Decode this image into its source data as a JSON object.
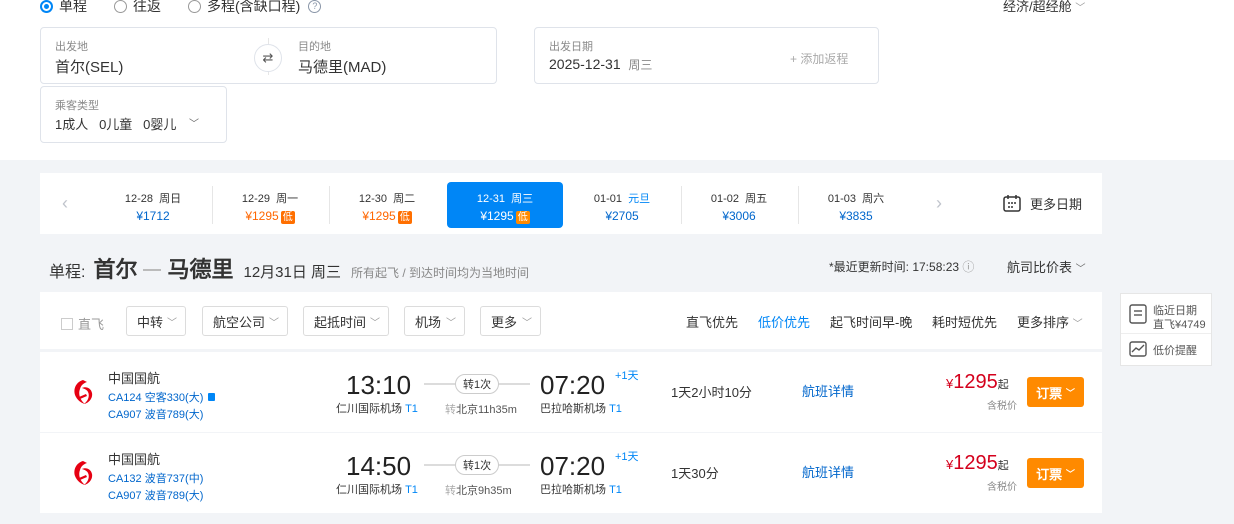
{
  "trip_types": [
    {
      "label": "单程",
      "selected": true
    },
    {
      "label": "往返",
      "selected": false
    },
    {
      "label": "多程(含缺口程)",
      "selected": false
    }
  ],
  "cabin_class": "经济/超经舱",
  "search": {
    "from_label": "出发地",
    "from_value": "首尔(SEL)",
    "to_label": "目的地",
    "to_value": "马德里(MAD)",
    "date_label": "出发日期",
    "date_value": "2025-12-31",
    "date_weekday": "周三",
    "add_leg": "+ 添加返程",
    "passenger_label": "乘客类型",
    "passenger_value": "1成人   0儿童   0婴儿"
  },
  "date_strip": [
    {
      "date": "12-28",
      "weekday": "周日",
      "price": "¥1712",
      "low": false,
      "selected": false
    },
    {
      "date": "12-29",
      "weekday": "周一",
      "price": "¥1295",
      "low": true,
      "selected": false
    },
    {
      "date": "12-30",
      "weekday": "周二",
      "price": "¥1295",
      "low": true,
      "selected": false
    },
    {
      "date": "12-31",
      "weekday": "周三",
      "price": "¥1295",
      "low": true,
      "selected": true
    },
    {
      "date": "01-01",
      "weekday": "元旦",
      "price": "¥2705",
      "low": false,
      "selected": false
    },
    {
      "date": "01-02",
      "weekday": "周五",
      "price": "¥3006",
      "low": false,
      "selected": false
    },
    {
      "date": "01-03",
      "weekday": "周六",
      "price": "¥3835",
      "low": false,
      "selected": false
    }
  ],
  "low_tag": "低",
  "more_dates": "更多日期",
  "route": {
    "prefix": "单程:",
    "from": "首尔",
    "to": "马德里",
    "date": "12月31日 周三",
    "note": "所有起飞 / 到达时间均为当地时间",
    "updated": "*最近更新时间: 17:58:23",
    "compare": "航司比价表"
  },
  "filters": {
    "direct": "直飞",
    "dropdowns": [
      "中转",
      "航空公司",
      "起抵时间",
      "机场",
      "更多"
    ],
    "sorts": [
      {
        "label": "直飞优先",
        "active": false
      },
      {
        "label": "低价优先",
        "active": true
      },
      {
        "label": "起飞时间早-晚",
        "active": false
      },
      {
        "label": "耗时短优先",
        "active": false
      },
      {
        "label": "更多排序",
        "active": false
      }
    ]
  },
  "sidebar": {
    "nearby_title": "临近日期",
    "nearby_sub": "直飞¥4749",
    "alert": "低价提醒"
  },
  "flights": [
    {
      "airline": "中国国航",
      "seg1": "CA124 空客330(大)",
      "seg2": "CA907 波音789(大)",
      "dep_time": "13:10",
      "dep_airport": "仁川国际机场",
      "dep_terminal": "T1",
      "transfer": "转1次",
      "via": "北京11h35m",
      "arr_time": "07:20",
      "plus_day": "+1天",
      "arr_airport": "巴拉哈斯机场",
      "arr_terminal": "T1",
      "duration": "1天2小时10分",
      "detail": "航班详情",
      "price": "1295",
      "price_suffix": "起",
      "tax": "含税价",
      "book": "订票"
    },
    {
      "airline": "中国国航",
      "seg1": "CA132 波音737(中)",
      "seg2": "CA907 波音789(大)",
      "dep_time": "14:50",
      "dep_airport": "仁川国际机场",
      "dep_terminal": "T1",
      "transfer": "转1次",
      "via": "北京9h35m",
      "arr_time": "07:20",
      "plus_day": "+1天",
      "arr_airport": "巴拉哈斯机场",
      "arr_terminal": "T1",
      "duration": "1天30分",
      "detail": "航班详情",
      "price": "1295",
      "price_suffix": "起",
      "tax": "含税价",
      "book": "订票"
    }
  ],
  "colors": {
    "accent": "#0086f6",
    "price": "#d4001c",
    "book": "#ff8a00",
    "low": "#ff6f00"
  }
}
